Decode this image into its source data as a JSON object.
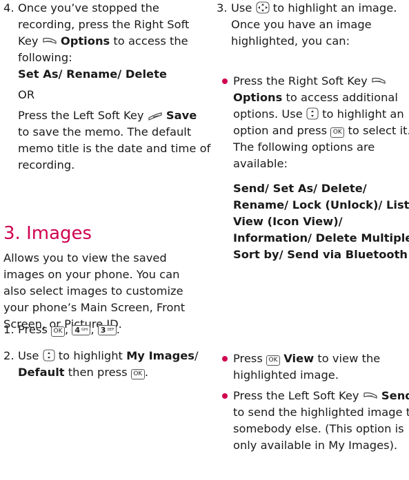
{
  "left": {
    "step4": {
      "num": "4.",
      "t1": "Once you’ve stopped the recording, press the Right Soft Key",
      "b1": "Options",
      "t2": "to access the following:",
      "opts": "Set As/ Rename/ Delete",
      "or": "OR",
      "t3": "Press the Left Soft Key",
      "b2": "Save",
      "t4": "to save the memo. The default memo title is the date and time of recording."
    },
    "heading": "3. Images",
    "intro": "Allows you to view the saved images on your phone. You can also select images to customize your phone’s Main Screen, Front Screen, or Picture ID.",
    "step1": {
      "num": "1.",
      "t": "Press",
      "sep1": ",",
      "sep2": ",",
      "end": "."
    },
    "step2": {
      "num": "2.",
      "t1": "Use",
      "t2": "to highlight",
      "b": "My Images",
      "t3": "/",
      "b2": "Default",
      "t4": "then press",
      "end": "."
    }
  },
  "right": {
    "step3": {
      "num": "3.",
      "t1": "Use",
      "t2": "to highlight an image. Once you have an image highlighted, you can:"
    },
    "bullet1": {
      "t1": "Press the Right Soft Key",
      "b": "Options",
      "t2": "to access additional options. Use",
      "t3": "to highlight an option and press",
      "t4": "to select it. The following options are available:",
      "opts": "Send/ Set As/ Delete/ Rename/ Lock (Unlock)/ List View (Icon View)/ Information/ Delete Multiple/ Sort by/ Send via Bluetooth"
    },
    "bullet2": {
      "t1": "Press",
      "b": "View",
      "t2": "to view the highlighted image."
    },
    "bullet3": {
      "t1": "Press the Left Soft Key",
      "b": "Send",
      "t2": "to send the highlighted image to somebody else. (This option is only available in My Images)."
    }
  },
  "keys": {
    "ok": "OK",
    "four_digit": "4",
    "four_letters": "GHI",
    "three_digit": "3",
    "three_letters": "DEF"
  },
  "icons": {
    "right_soft_key": "right-soft-key-icon",
    "left_soft_key": "left-soft-key-icon",
    "nav_key": "navigation-key-icon",
    "updown_key": "up-down-navigation-key-icon"
  },
  "colors": {
    "accent": "#d0004f",
    "text": "#1a1a1a"
  }
}
